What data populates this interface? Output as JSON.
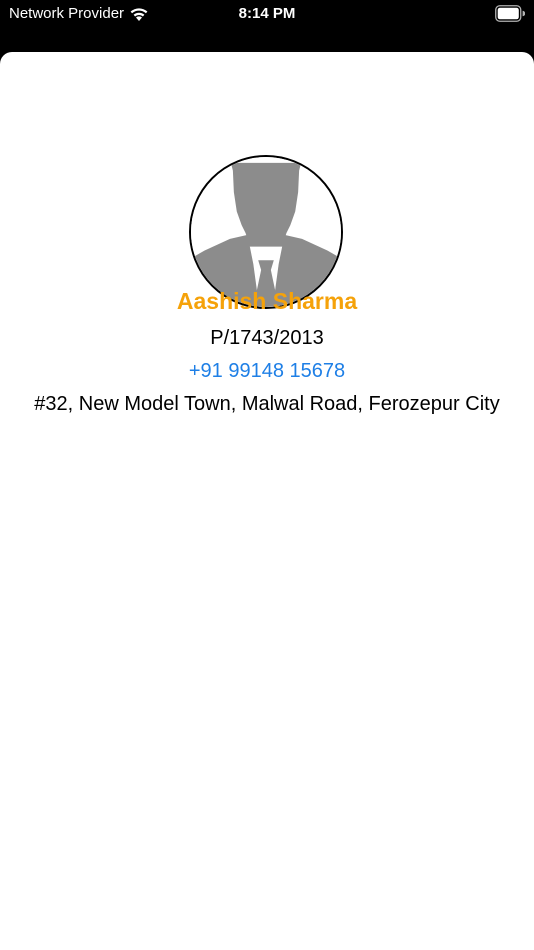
{
  "status_bar": {
    "carrier": "Network Provider",
    "time": "8:14 PM",
    "wifi_icon": "wifi-icon",
    "battery_icon": "battery-icon"
  },
  "profile": {
    "avatar_icon": "person-placeholder-icon",
    "name": "Aashish Sharma",
    "registration": "P/1743/2013",
    "phone": "+91 99148 15678",
    "address": "#32, New Model Town, Malwal Road, Ferozepur City"
  },
  "colors": {
    "name": "#F5A20A",
    "phone": "#1E7FE6"
  }
}
